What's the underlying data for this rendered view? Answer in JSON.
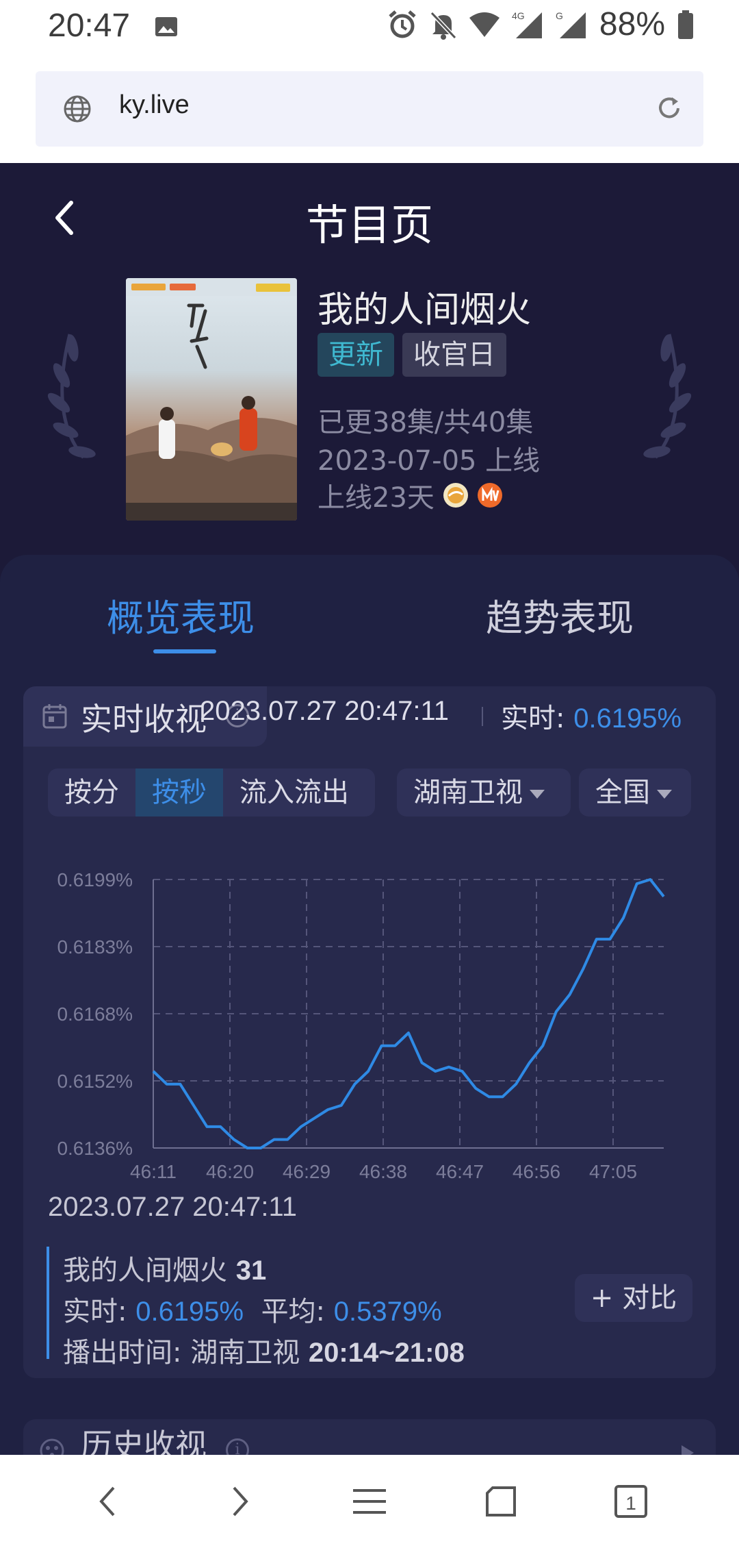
{
  "status_bar": {
    "time": "20:47",
    "battery": "88%",
    "network_4g": "4G",
    "network_g": "G"
  },
  "browser": {
    "url": "ky.live"
  },
  "header": {
    "title": "节目页"
  },
  "show": {
    "name": "我的人间烟火",
    "tags": [
      "更新",
      "收官日"
    ],
    "episodes": "已更38集/共40集",
    "premiere": "2023-07-05 上线",
    "days_online": "上线23天"
  },
  "tabs": [
    "概览表现",
    "趋势表现"
  ],
  "realtime": {
    "title": "实时收视",
    "timestamp": "2023.07.27 20:47:11",
    "label": "实时: ",
    "value": "0.6195%"
  },
  "controls": {
    "segments": [
      "按分",
      "按秒",
      "流入流出"
    ],
    "channel": "湖南卫视",
    "region": "全国"
  },
  "chart_data": {
    "type": "line",
    "y_tick_labels": [
      "0.6199%",
      "0.6183%",
      "0.6168%",
      "0.6152%",
      "0.6136%"
    ],
    "x_tick_labels": [
      "46:11",
      "46:20",
      "46:29",
      "46:38",
      "46:47",
      "46:56",
      "47:05"
    ],
    "ylim": [
      0.6136,
      0.6199
    ],
    "grid": true,
    "series": [
      {
        "color": "#2f8ae5",
        "values": [
          0.6154,
          0.6151,
          0.6151,
          0.6146,
          0.6141,
          0.6141,
          0.6138,
          0.6136,
          0.6136,
          0.6138,
          0.6138,
          0.6141,
          0.6143,
          0.6145,
          0.6146,
          0.6151,
          0.6154,
          0.616,
          0.616,
          0.6163,
          0.6156,
          0.6154,
          0.6155,
          0.6154,
          0.615,
          0.6148,
          0.6148,
          0.6151,
          0.6156,
          0.616,
          0.6168,
          0.6172,
          0.6178,
          0.6185,
          0.6185,
          0.619,
          0.6198,
          0.6199,
          0.6195
        ]
      }
    ]
  },
  "detail": {
    "timestamp": "2023.07.27 20:47:11",
    "program": "我的人间烟火",
    "episode": "31",
    "realtime_label": "实时:",
    "realtime_value": "0.6195%",
    "avg_label": "平均:",
    "avg_value": "0.5379%",
    "airtime_label": "播出时间:",
    "airtime_channel": "湖南卫视",
    "airtime_range": "20:14~21:08",
    "compare_label": "+ 对比"
  },
  "history": {
    "title": "历史收视"
  },
  "navbar": {
    "tab_count": "1"
  }
}
